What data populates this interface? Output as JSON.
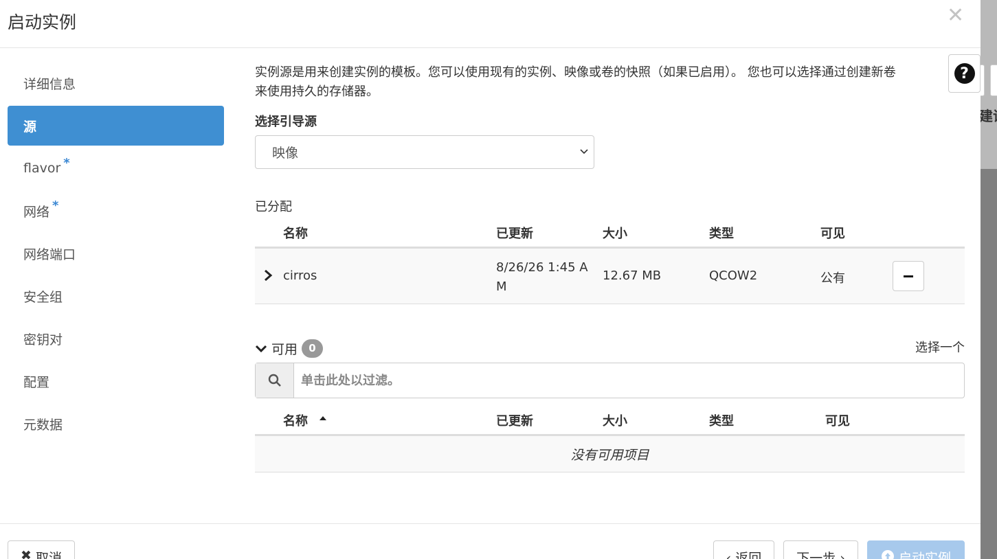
{
  "modal": {
    "title": "启动实例"
  },
  "sidebar": {
    "items": [
      {
        "label": "详细信息",
        "required": ""
      },
      {
        "label": "源",
        "required": ""
      },
      {
        "label": "flavor",
        "required": "*"
      },
      {
        "label": "网络",
        "required": "*"
      },
      {
        "label": "网络端口",
        "required": ""
      },
      {
        "label": "安全组",
        "required": ""
      },
      {
        "label": "密钥对",
        "required": ""
      },
      {
        "label": "配置",
        "required": ""
      },
      {
        "label": "元数据",
        "required": ""
      }
    ]
  },
  "content": {
    "description_line1": "实例源是用来创建实例的模板。您可以使用现有的实例、映像或卷的快照（如果已启用）。 您也可以选择通过创建新卷",
    "description_line2": "来使用持久的存储器。",
    "boot_source_label": "选择引导源",
    "boot_source_value": "映像",
    "allocated_label": "已分配",
    "available_label": "可用",
    "available_count": "0",
    "select_one": "选择一个",
    "filter_placeholder": "单击此处以过滤。",
    "empty_text": "没有可用项目"
  },
  "allocated_table": {
    "headers": {
      "name": "名称",
      "updated": "已更新",
      "size": "大小",
      "type": "类型",
      "visibility": "可见"
    },
    "rows": [
      {
        "name": "cirros",
        "updated_line1": "8/26/26 1:45 A",
        "updated_line2": "M",
        "size": "12.67 MB",
        "type": "QCOW2",
        "visibility": "公有"
      }
    ]
  },
  "available_table": {
    "headers": {
      "name": "名称",
      "updated": "已更新",
      "size": "大小",
      "type": "类型",
      "visibility": "可见"
    }
  },
  "footer": {
    "cancel": "取消",
    "back": "‹ 返回",
    "next": "下一步 ›",
    "launch": "启动实例"
  },
  "overlay": {
    "peek_text": "建议"
  },
  "colors": {
    "accent": "#3f8fd2",
    "launch_disabled": "#a7c9ec",
    "badge": "#999999"
  }
}
